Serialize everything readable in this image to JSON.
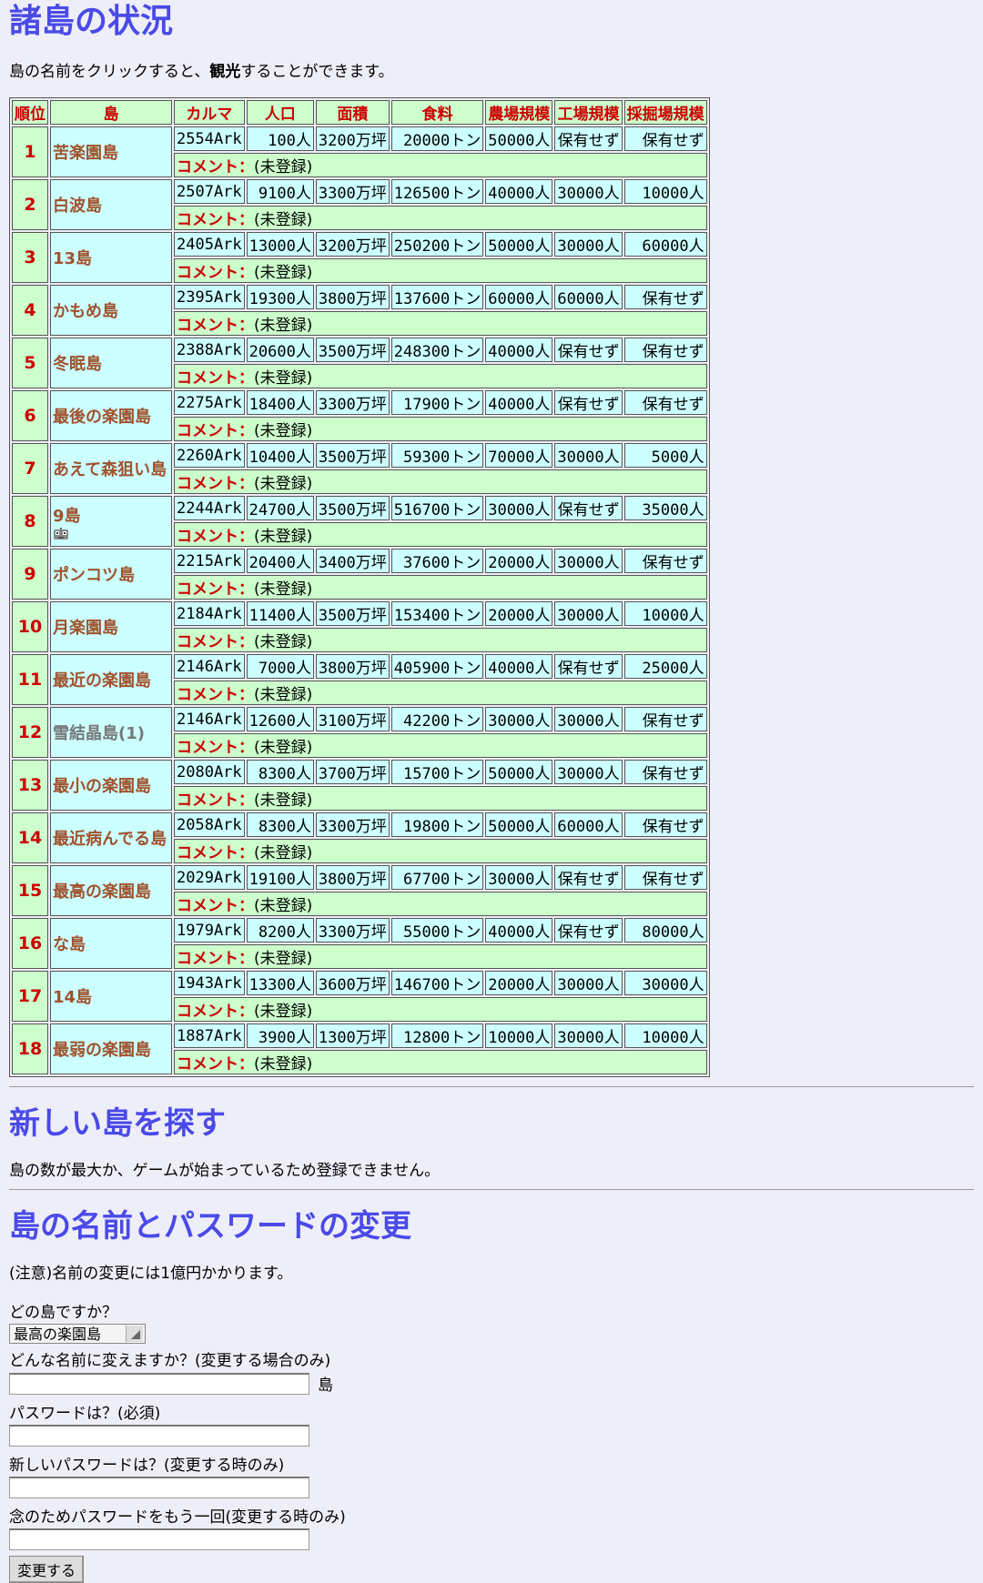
{
  "title": "諸島の状況",
  "note_prefix": "島の名前をクリックすると、",
  "note_bold": "観光",
  "note_suffix": "することができます。",
  "headers": [
    "順位",
    "島",
    "カルマ",
    "人口",
    "面積",
    "食料",
    "農場規模",
    "工場規模",
    "採掘場規模"
  ],
  "comment_label": "コメント：",
  "comment_value": "(未登録)",
  "rows": [
    {
      "rank": "1",
      "name": "苦楽園島",
      "karma": "2554Ark",
      "pop": "100人",
      "area": "3200万坪",
      "food": "20000トン",
      "farm": "50000人",
      "factory": "保有せず",
      "mine": "保有せず"
    },
    {
      "rank": "2",
      "name": "白波島",
      "karma": "2507Ark",
      "pop": "9100人",
      "area": "3300万坪",
      "food": "126500トン",
      "farm": "40000人",
      "factory": "30000人",
      "mine": "10000人"
    },
    {
      "rank": "3",
      "name": "13島",
      "karma": "2405Ark",
      "pop": "13000人",
      "area": "3200万坪",
      "food": "250200トン",
      "farm": "50000人",
      "factory": "30000人",
      "mine": "60000人"
    },
    {
      "rank": "4",
      "name": "かもめ島",
      "karma": "2395Ark",
      "pop": "19300人",
      "area": "3800万坪",
      "food": "137600トン",
      "farm": "60000人",
      "factory": "60000人",
      "mine": "保有せず"
    },
    {
      "rank": "5",
      "name": "冬眠島",
      "karma": "2388Ark",
      "pop": "20600人",
      "area": "3500万坪",
      "food": "248300トン",
      "farm": "40000人",
      "factory": "保有せず",
      "mine": "保有せず"
    },
    {
      "rank": "6",
      "name": "最後の楽園島",
      "karma": "2275Ark",
      "pop": "18400人",
      "area": "3300万坪",
      "food": "17900トン",
      "farm": "40000人",
      "factory": "保有せず",
      "mine": "保有せず"
    },
    {
      "rank": "7",
      "name": "あえて森狙い島",
      "karma": "2260Ark",
      "pop": "10400人",
      "area": "3500万坪",
      "food": "59300トン",
      "farm": "70000人",
      "factory": "30000人",
      "mine": "5000人"
    },
    {
      "rank": "8",
      "name": "9島",
      "karma": "2244Ark",
      "pop": "24700人",
      "area": "3500万坪",
      "food": "516700トン",
      "farm": "30000人",
      "factory": "保有せず",
      "mine": "35000人",
      "icon": "robot-icon"
    },
    {
      "rank": "9",
      "name": "ポンコツ島",
      "karma": "2215Ark",
      "pop": "20400人",
      "area": "3400万坪",
      "food": "37600トン",
      "farm": "20000人",
      "factory": "30000人",
      "mine": "保有せず"
    },
    {
      "rank": "10",
      "name": "月楽園島",
      "karma": "2184Ark",
      "pop": "11400人",
      "area": "3500万坪",
      "food": "153400トン",
      "farm": "20000人",
      "factory": "30000人",
      "mine": "10000人"
    },
    {
      "rank": "11",
      "name": "最近の楽園島",
      "karma": "2146Ark",
      "pop": "7000人",
      "area": "3800万坪",
      "food": "405900トン",
      "farm": "40000人",
      "factory": "保有せず",
      "mine": "25000人"
    },
    {
      "rank": "12",
      "name": "雪結晶島(1)",
      "karma": "2146Ark",
      "pop": "12600人",
      "area": "3100万坪",
      "food": "42200トン",
      "farm": "30000人",
      "factory": "30000人",
      "mine": "保有せず",
      "gray": true
    },
    {
      "rank": "13",
      "name": "最小の楽園島",
      "karma": "2080Ark",
      "pop": "8300人",
      "area": "3700万坪",
      "food": "15700トン",
      "farm": "50000人",
      "factory": "30000人",
      "mine": "保有せず"
    },
    {
      "rank": "14",
      "name": "最近病んでる島",
      "karma": "2058Ark",
      "pop": "8300人",
      "area": "3300万坪",
      "food": "19800トン",
      "farm": "50000人",
      "factory": "60000人",
      "mine": "保有せず"
    },
    {
      "rank": "15",
      "name": "最高の楽園島",
      "karma": "2029Ark",
      "pop": "19100人",
      "area": "3800万坪",
      "food": "67700トン",
      "farm": "30000人",
      "factory": "保有せず",
      "mine": "保有せず"
    },
    {
      "rank": "16",
      "name": "な島",
      "karma": "1979Ark",
      "pop": "8200人",
      "area": "3300万坪",
      "food": "55000トン",
      "farm": "40000人",
      "factory": "保有せず",
      "mine": "80000人"
    },
    {
      "rank": "17",
      "name": "14島",
      "karma": "1943Ark",
      "pop": "13300人",
      "area": "3600万坪",
      "food": "146700トン",
      "farm": "20000人",
      "factory": "30000人",
      "mine": "30000人"
    },
    {
      "rank": "18",
      "name": "最弱の楽園島",
      "karma": "1887Ark",
      "pop": "3900人",
      "area": "1300万坪",
      "food": "12800トン",
      "farm": "10000人",
      "factory": "30000人",
      "mine": "10000人"
    }
  ],
  "new_island": {
    "heading": "新しい島を探す",
    "message": "島の数が最大か、ゲームが始まっているため登録できません。"
  },
  "change_form": {
    "heading": "島の名前とパスワードの変更",
    "caution": "(注意)名前の変更には1億円かかります。",
    "which_label": "どの島ですか？",
    "which_selected": "最高の楽園島",
    "name_label": "どんな名前に変えますか？(変更する場合のみ)",
    "name_suffix": "島",
    "password_label": "パスワードは？(必須)",
    "new_password_label": "新しいパスワードは？(変更する時のみ)",
    "confirm_label": "念のためパスワードをもう一回(変更する時のみ)",
    "submit_label": "変更する"
  },
  "colors": {
    "heading": "#4a4ae8",
    "header_bg": "#ccffcc",
    "cell_bg": "#ccffff",
    "label_red": "#cc0000",
    "island_link": "#a0522d"
  }
}
